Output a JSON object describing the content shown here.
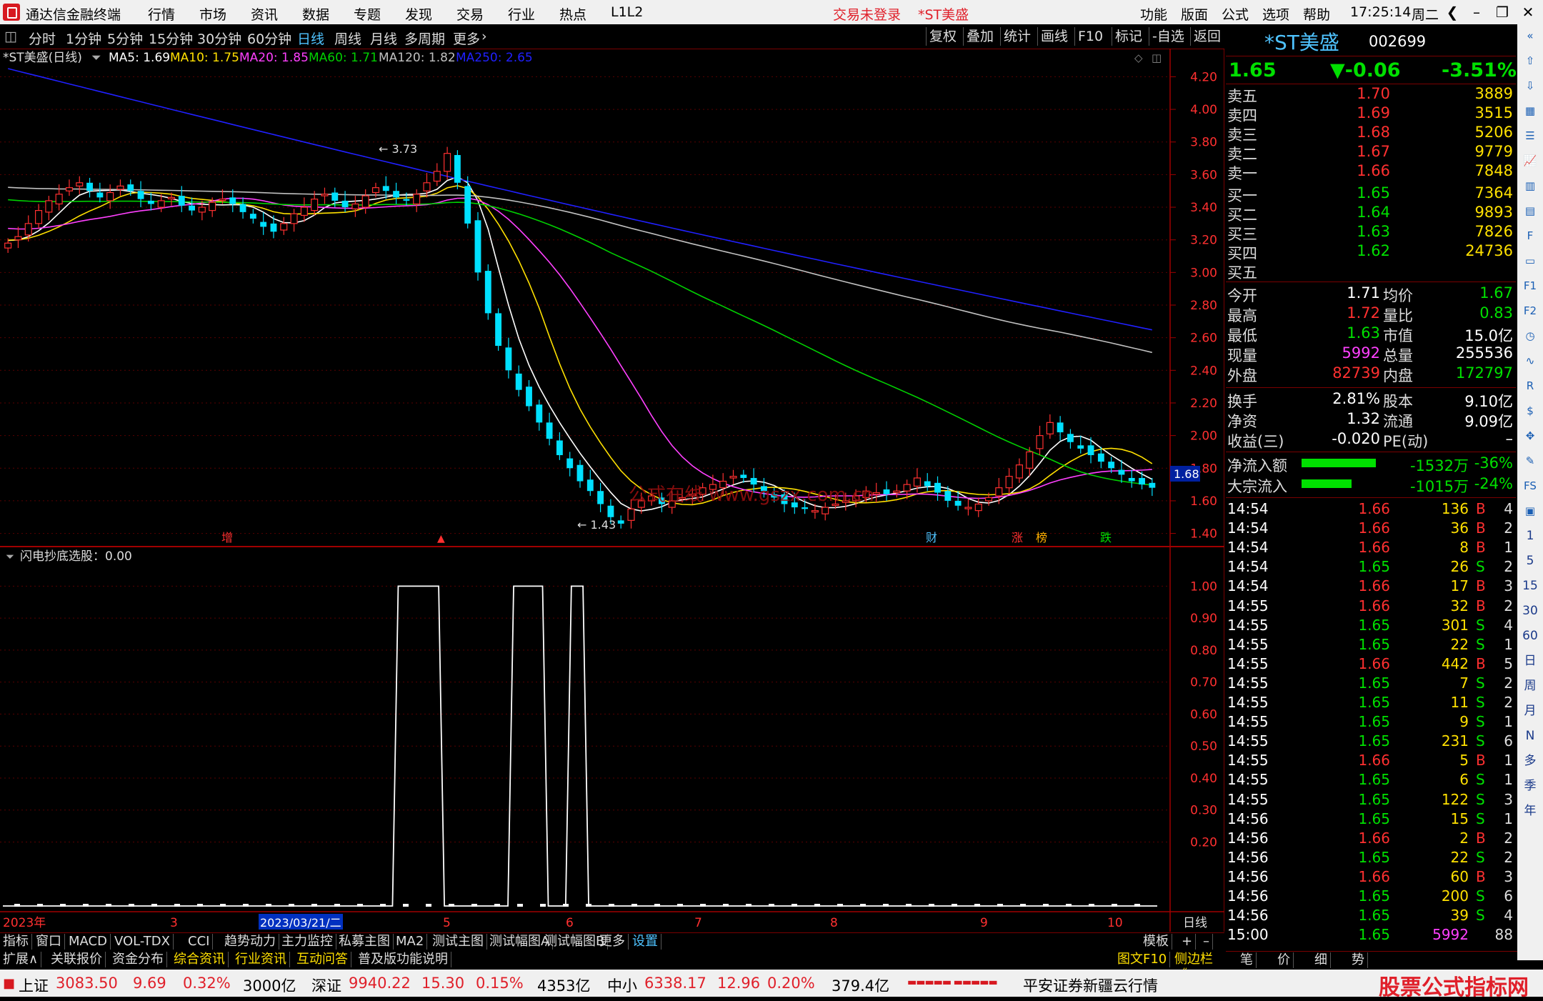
{
  "menubar": {
    "title": "通达信金融终端",
    "items": [
      "行情",
      "市场",
      "资讯",
      "数据",
      "专题",
      "发现",
      "交易",
      "行业",
      "热点",
      "L1L2"
    ],
    "trade_status": "交易未登录",
    "stock_name": "*ST美盛",
    "right_items": [
      "功能",
      "版面",
      "公式",
      "选项",
      "帮助"
    ],
    "time": "17:25:14",
    "weekday": "周二"
  },
  "periods": [
    "分时",
    "1分钟",
    "5分钟",
    "15分钟",
    "30分钟",
    "60分钟",
    "日线",
    "周线",
    "月线",
    "多周期",
    "更多"
  ],
  "active_period": "日线",
  "chart_buttons": [
    "复权",
    "叠加",
    "统计",
    "画线",
    "F10",
    "标记",
    "-自选",
    "返回"
  ],
  "legend": {
    "name": "*ST美盛(日线)",
    "ma5": "MA5: 1.69",
    "ma10": "MA10: 1.75",
    "ma20": "MA20: 1.85",
    "ma60": "MA60: 1.71",
    "ma120": "MA120: 1.82",
    "ma250": "MA250: 2.65"
  },
  "indicator_label": "闪电抄底选股：0.00",
  "watermark": "公式在线 www.gszx.com.cn",
  "annotations": {
    "high": "3.73",
    "low": "1.43",
    "price_tag": "1.68",
    "marks": [
      "增",
      "财",
      "涨",
      "榜",
      "跌"
    ]
  },
  "x_axis": {
    "labels": [
      "2023年",
      "3",
      "2023/03/21/二",
      "5",
      "6",
      "7",
      "8",
      "9",
      "10"
    ],
    "period_label": "日线"
  },
  "chart_data": [
    {
      "type": "candlestick",
      "title": "*ST美盛(日线)",
      "ylim": [
        1.35,
        4.25
      ],
      "y_ticks": [
        4.2,
        4.0,
        3.8,
        3.6,
        3.4,
        3.2,
        3.0,
        2.8,
        2.6,
        2.4,
        2.2,
        2.0,
        1.8,
        1.6,
        1.4
      ],
      "x_ticks": [
        "2023年",
        "3",
        "2023/03/21/二",
        "5",
        "6",
        "7",
        "8",
        "9",
        "10"
      ],
      "close_series": [
        3.18,
        3.22,
        3.3,
        3.38,
        3.44,
        3.48,
        3.52,
        3.55,
        3.5,
        3.46,
        3.49,
        3.53,
        3.5,
        3.45,
        3.42,
        3.44,
        3.46,
        3.41,
        3.38,
        3.4,
        3.43,
        3.45,
        3.42,
        3.37,
        3.33,
        3.28,
        3.25,
        3.3,
        3.36,
        3.4,
        3.45,
        3.48,
        3.44,
        3.4,
        3.42,
        3.47,
        3.52,
        3.5,
        3.46,
        3.44,
        3.48,
        3.55,
        3.62,
        3.73,
        3.55,
        3.3,
        3.0,
        2.75,
        2.55,
        2.4,
        2.28,
        2.18,
        2.08,
        1.98,
        1.88,
        1.8,
        1.72,
        1.66,
        1.58,
        1.5,
        1.46,
        1.55,
        1.6,
        1.63,
        1.58,
        1.6,
        1.62,
        1.64,
        1.68,
        1.7,
        1.72,
        1.75,
        1.74,
        1.7,
        1.66,
        1.62,
        1.58,
        1.56,
        1.55,
        1.54,
        1.56,
        1.58,
        1.6,
        1.63,
        1.66,
        1.65,
        1.64,
        1.66,
        1.7,
        1.74,
        1.69,
        1.65,
        1.6,
        1.57,
        1.56,
        1.58,
        1.62,
        1.68,
        1.75,
        1.82,
        1.9,
        2.0,
        2.08,
        2.02,
        1.96,
        1.92,
        1.88,
        1.84,
        1.8,
        1.76,
        1.72,
        1.7,
        1.68
      ],
      "series": [
        {
          "name": "MA5",
          "color": "#ffffff",
          "last": 1.69
        },
        {
          "name": "MA10",
          "color": "#ffe000",
          "last": 1.75
        },
        {
          "name": "MA20",
          "color": "#ff40ff",
          "last": 1.85
        },
        {
          "name": "MA60",
          "color": "#00d000",
          "last": 1.71
        },
        {
          "name": "MA120",
          "color": "#c0c0c0",
          "last": 1.82
        },
        {
          "name": "MA250",
          "color": "#2020ff",
          "last": 2.65
        }
      ]
    },
    {
      "type": "line",
      "title": "闪电抄底选股",
      "ylim": [
        0,
        1.05
      ],
      "y_ticks": [
        1.0,
        0.9,
        0.8,
        0.7,
        0.6,
        0.5,
        0.4,
        0.3,
        0.2
      ],
      "signal_windows": [
        [
          0.34,
          0.38
        ],
        [
          0.44,
          0.47
        ],
        [
          0.49,
          0.505
        ]
      ],
      "last": 0.0
    }
  ],
  "quote": {
    "name": "*ST美盛",
    "code": "002699",
    "price": "1.65",
    "change": "▼-0.06",
    "pct": "-3.51%",
    "asks": [
      {
        "label": "卖五",
        "price": "1.70",
        "vol": "3889"
      },
      {
        "label": "卖四",
        "price": "1.69",
        "vol": "3515"
      },
      {
        "label": "卖三",
        "price": "1.68",
        "vol": "5206"
      },
      {
        "label": "卖二",
        "price": "1.67",
        "vol": "9779"
      },
      {
        "label": "卖一",
        "price": "1.66",
        "vol": "7848"
      }
    ],
    "bids": [
      {
        "label": "买一",
        "price": "1.65",
        "vol": "7364"
      },
      {
        "label": "买二",
        "price": "1.64",
        "vol": "9893"
      },
      {
        "label": "买三",
        "price": "1.63",
        "vol": "7826"
      },
      {
        "label": "买四",
        "price": "1.62",
        "vol": "24736"
      },
      {
        "label": "买五",
        "price": "",
        "vol": ""
      }
    ],
    "stats": [
      {
        "l1": "今开",
        "v1": "1.71",
        "c1": "white",
        "l2": "均价",
        "v2": "1.67",
        "c2": "green"
      },
      {
        "l1": "最高",
        "v1": "1.72",
        "c1": "red2",
        "l2": "量比",
        "v2": "0.83",
        "c2": "green"
      },
      {
        "l1": "最低",
        "v1": "1.63",
        "c1": "green",
        "l2": "市值",
        "v2": "15.0亿",
        "c2": "white"
      },
      {
        "l1": "现量",
        "v1": "5992",
        "c1": "magenta",
        "l2": "总量",
        "v2": "255536",
        "c2": "white"
      },
      {
        "l1": "外盘",
        "v1": "82739",
        "c1": "red2",
        "l2": "内盘",
        "v2": "172797",
        "c2": "green"
      }
    ],
    "stats2": [
      {
        "l1": "换手",
        "v1": "2.81%",
        "l2": "股本",
        "v2": "9.10亿"
      },
      {
        "l1": "净资",
        "v1": "1.32",
        "l2": "流通",
        "v2": "9.09亿"
      },
      {
        "l1": "收益(三)",
        "v1": "-0.020",
        "l2": "PE(动)",
        "v2": "–"
      }
    ],
    "flows": [
      {
        "label": "净流入额",
        "amount": "-1532万",
        "pct": "-36%",
        "bar": 0.36
      },
      {
        "label": "大宗流入",
        "amount": "-1015万",
        "pct": "-24%",
        "bar": 0.24
      }
    ]
  },
  "ticks": [
    {
      "t": "14:54",
      "p": "1.66",
      "v": "136",
      "s": "B",
      "n": "4"
    },
    {
      "t": "14:54",
      "p": "1.66",
      "v": "36",
      "s": "B",
      "n": "2"
    },
    {
      "t": "14:54",
      "p": "1.66",
      "v": "8",
      "s": "B",
      "n": "1"
    },
    {
      "t": "14:54",
      "p": "1.65",
      "v": "26",
      "s": "S",
      "n": "2"
    },
    {
      "t": "14:54",
      "p": "1.66",
      "v": "17",
      "s": "B",
      "n": "3"
    },
    {
      "t": "14:55",
      "p": "1.66",
      "v": "32",
      "s": "B",
      "n": "2"
    },
    {
      "t": "14:55",
      "p": "1.65",
      "v": "301",
      "s": "S",
      "n": "4"
    },
    {
      "t": "14:55",
      "p": "1.65",
      "v": "22",
      "s": "S",
      "n": "1"
    },
    {
      "t": "14:55",
      "p": "1.66",
      "v": "442",
      "s": "B",
      "n": "5"
    },
    {
      "t": "14:55",
      "p": "1.65",
      "v": "7",
      "s": "S",
      "n": "2"
    },
    {
      "t": "14:55",
      "p": "1.65",
      "v": "11",
      "s": "S",
      "n": "2"
    },
    {
      "t": "14:55",
      "p": "1.65",
      "v": "9",
      "s": "S",
      "n": "1"
    },
    {
      "t": "14:55",
      "p": "1.65",
      "v": "231",
      "s": "S",
      "n": "6"
    },
    {
      "t": "14:55",
      "p": "1.66",
      "v": "5",
      "s": "B",
      "n": "1"
    },
    {
      "t": "14:55",
      "p": "1.65",
      "v": "6",
      "s": "S",
      "n": "1"
    },
    {
      "t": "14:55",
      "p": "1.65",
      "v": "122",
      "s": "S",
      "n": "3"
    },
    {
      "t": "14:56",
      "p": "1.65",
      "v": "15",
      "s": "S",
      "n": "1"
    },
    {
      "t": "14:56",
      "p": "1.66",
      "v": "2",
      "s": "B",
      "n": "2"
    },
    {
      "t": "14:56",
      "p": "1.65",
      "v": "22",
      "s": "S",
      "n": "2"
    },
    {
      "t": "14:56",
      "p": "1.66",
      "v": "60",
      "s": "B",
      "n": "3"
    },
    {
      "t": "14:56",
      "p": "1.65",
      "v": "200",
      "s": "S",
      "n": "6"
    },
    {
      "t": "14:56",
      "p": "1.65",
      "v": "39",
      "s": "S",
      "n": "4"
    },
    {
      "t": "15:00",
      "p": "1.65",
      "v": "5992",
      "s": "",
      "n": "88"
    }
  ],
  "bottom_tabs": [
    "指标",
    "窗口",
    "MACD",
    "VOL-TDX",
    "CCI",
    "趋势动力",
    "主力监控",
    "私募主图",
    "MA2",
    "测试主图",
    "测试幅图A",
    "测试幅图B",
    "更多",
    "设置"
  ],
  "bottom_right": [
    "模板",
    "+",
    "–"
  ],
  "bottom_tabs2": [
    "扩展∧",
    "关联报价",
    "资金分布",
    "综合资讯",
    "行业资讯",
    "互动问答",
    "普及版功能说明"
  ],
  "bottom_right2": [
    "图文F10",
    "侧边栏《",
    "笔",
    "价",
    "细",
    "势"
  ],
  "status": {
    "sh_label": "上证",
    "sh_val": "3083.50",
    "sh_chg": "9.69",
    "sh_pct": "0.32%",
    "sh_amt": "3000亿",
    "sz_label": "深证",
    "sz_val": "9940.22",
    "sz_chg": "15.30",
    "sz_pct": "0.15%",
    "sz_amt": "4353亿",
    "zx_label": "中小",
    "zx_val": "6338.17",
    "zx_chg": "12.96",
    "zx_pct": "0.20%",
    "zx_amt": "379.4亿",
    "broker": "平安证券新疆云行情",
    "brand": "股票公式指标网",
    "brand_url": "www.gszx.com.cn"
  },
  "side_icons": [
    "collapse-icon",
    "up-icon",
    "down-icon",
    "grid-icon",
    "list-icon",
    "chart-icon",
    "kline-icon",
    "table-icon",
    "f10-icon",
    "doc-icon",
    "f1-icon",
    "f2-icon",
    "clock-icon",
    "wave-icon",
    "rsi-icon",
    "money-icon",
    "move-icon",
    "pen-icon",
    "fs-icon",
    "layout-icon",
    "1",
    "5",
    "15",
    "30",
    "60",
    "日",
    "周",
    "月",
    "N",
    "多",
    "季",
    "年"
  ],
  "colors": {
    "up": "#ff3030",
    "down": "#00e0ff",
    "ma250": "#2020ff",
    "axis": "#a00000"
  }
}
